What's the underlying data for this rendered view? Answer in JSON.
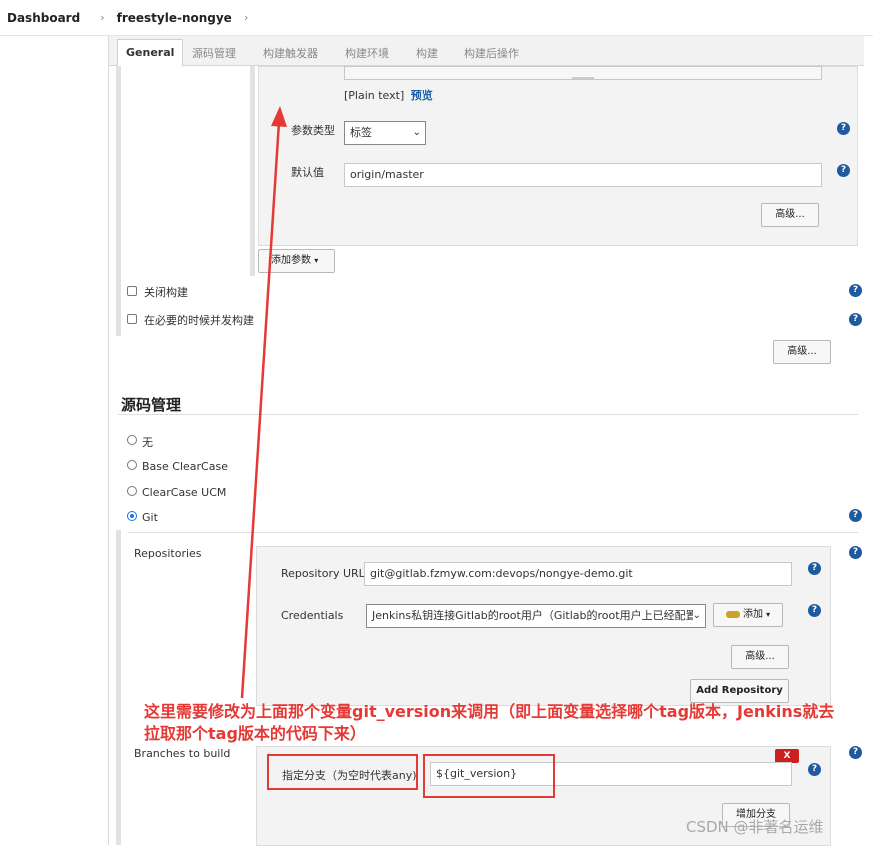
{
  "breadcrumb": {
    "dashboard": "Dashboard",
    "job": "freestyle-nongye"
  },
  "tabs": [
    "General",
    "源码管理",
    "构建触发器",
    "构建环境",
    "构建",
    "构建后操作"
  ],
  "param": {
    "plain_text": "[Plain text]",
    "preview": "预览",
    "type_label": "参数类型",
    "type_value": "标签",
    "default_label": "默认值",
    "default_value": "origin/master",
    "advanced": "高级...",
    "add_param": "添加参数"
  },
  "general": {
    "disable_build": "关闭构建",
    "concurrent_build": "在必要的时候并发构建",
    "advanced": "高级..."
  },
  "scm": {
    "title": "源码管理",
    "options": [
      "无",
      "Base ClearCase",
      "ClearCase UCM",
      "Git"
    ],
    "selected": "Git",
    "repositories_label": "Repositories",
    "repo_url_label": "Repository URL",
    "repo_url_value": "git@gitlab.fzmyw.com:devops/nongye-demo.git",
    "credentials_label": "Credentials",
    "credentials_value": "Jenkins私钥连接Gitlab的root用户（Gitlab的root用户上已经配置",
    "add_cred": "添加",
    "advanced": "高级...",
    "add_repo": "Add Repository",
    "branches_label": "Branches to build",
    "branch_spec_label": "指定分支（为空时代表any)",
    "branch_spec_value": "${git_version}",
    "delete": "X",
    "add_branch": "增加分支"
  },
  "annotation": "这里需要修改为上面那个变量git_version来调用（即上面变量选择哪个tag版本，Jenkins就去拉取那个tag版本的代码下来）",
  "watermark": "CSDN @非著名运维",
  "colors": {
    "help": "#1f5a9e",
    "annotation": "#e53935",
    "radio_selected": "#1a73e8"
  }
}
